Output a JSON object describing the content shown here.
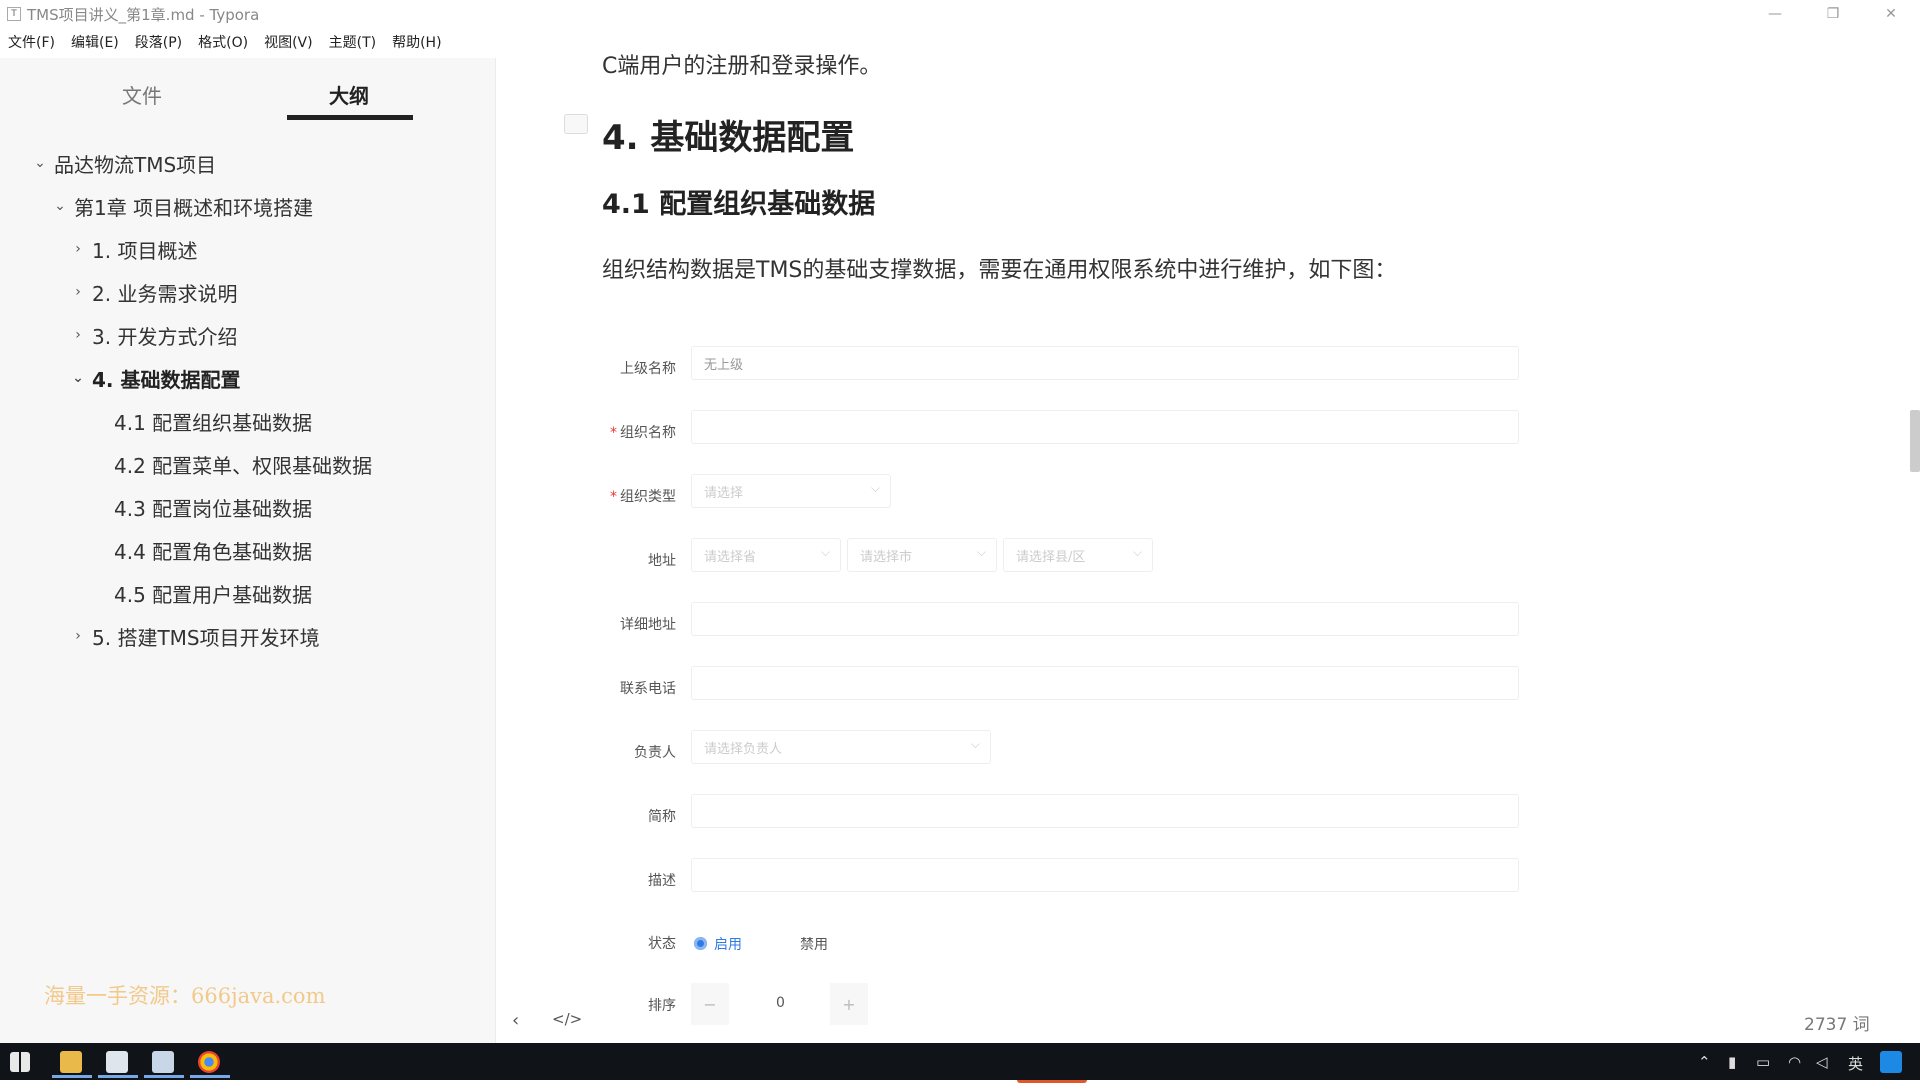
{
  "window": {
    "title": "TMS项目讲义_第1章.md - Typora",
    "app_icon": "T",
    "controls": [
      "—",
      "❐",
      "✕"
    ]
  },
  "menu": {
    "items": [
      "文件(F)",
      "编辑(E)",
      "段落(P)",
      "格式(O)",
      "视图(V)",
      "主题(T)",
      "帮助(H)"
    ]
  },
  "sidebar": {
    "tab_file": "文件",
    "tab_outline": "大纲",
    "outline": [
      {
        "label": "品达物流TMS项目",
        "chev": "⌄"
      },
      {
        "label": "第1章 项目概述和环境搭建",
        "chev": "⌄"
      },
      {
        "label": "1. 项目概述",
        "chev": "›"
      },
      {
        "label": "2. 业务需求说明",
        "chev": "›"
      },
      {
        "label": "3. 开发方式介绍",
        "chev": "›"
      },
      {
        "label": "4. 基础数据配置",
        "chev": "⌄"
      },
      {
        "label": "4.1 配置组织基础数据",
        "chev": ""
      },
      {
        "label": "4.2 配置菜单、权限基础数据",
        "chev": ""
      },
      {
        "label": "4.3 配置岗位基础数据",
        "chev": ""
      },
      {
        "label": "4.4 配置角色基础数据",
        "chev": ""
      },
      {
        "label": "4.5 配置用户基础数据",
        "chev": ""
      },
      {
        "label": "5. 搭建TMS项目开发环境",
        "chev": "›"
      }
    ],
    "watermark": "海量一手资源：666java.com"
  },
  "document": {
    "intro_line": "C端用户的注册和登录操作。",
    "heading1": "4. 基础数据配置",
    "heading2": "4.1 配置组织基础数据",
    "body": "组织结构数据是TMS的基础支撑数据，需要在通用权限系统中进行维护，如下图：",
    "form": {
      "parent_label": "上级名称",
      "parent_value": "无上级",
      "org_name_label": "组织名称",
      "org_type_label": "组织类型",
      "org_type_placeholder": "请选择",
      "address_label": "地址",
      "province_placeholder": "请选择省",
      "city_placeholder": "请选择市",
      "district_placeholder": "请选择县/区",
      "detail_address_label": "详细地址",
      "phone_label": "联系电话",
      "manager_label": "负责人",
      "manager_placeholder": "请选择负责人",
      "short_name_label": "简称",
      "description_label": "描述",
      "status_label": "状态",
      "status_enabled": "启用",
      "status_disabled": "禁用",
      "sort_label": "排序",
      "sort_value": "0",
      "minus": "−",
      "plus": "+",
      "required_mark": "*"
    },
    "footer": {
      "back_icon": "‹",
      "source_icon": "</>",
      "word_count": "2737 词"
    }
  },
  "taskbar": {
    "ime": "英",
    "colors": {
      "accent": "#76a9e6",
      "background": "#101418"
    }
  }
}
